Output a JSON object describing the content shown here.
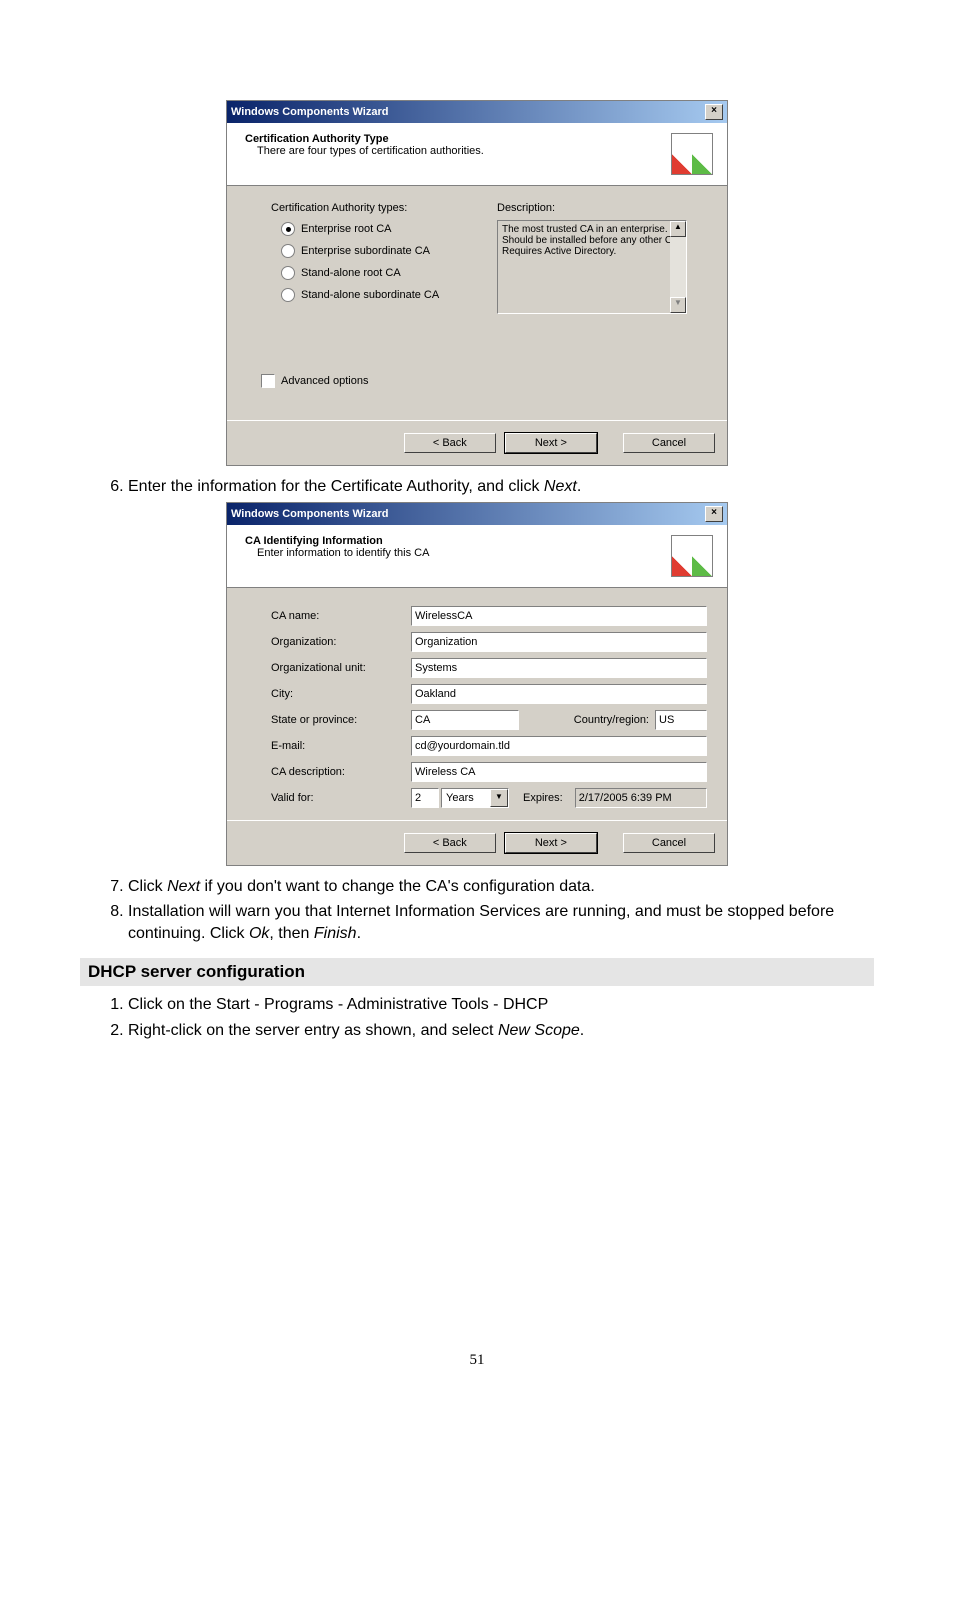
{
  "dialog1": {
    "title": "Windows Components Wizard",
    "header_title": "Certification Authority Type",
    "header_sub": "There are four types of certification authorities.",
    "types_label": "Certification Authority types:",
    "radios": [
      "Enterprise root CA",
      "Enterprise subordinate CA",
      "Stand-alone root CA",
      "Stand-alone subordinate CA"
    ],
    "desc_label": "Description:",
    "desc_text": "The most trusted CA in an enterprise. Should be installed before any other CA. Requires Active Directory.",
    "advanced": "Advanced options",
    "back": "< Back",
    "next": "Next >",
    "cancel": "Cancel"
  },
  "step6": "Enter the information for the Certificate Authority, and click ",
  "step6_em": "Next",
  "dialog2": {
    "title": "Windows Components Wizard",
    "header_title": "CA Identifying Information",
    "header_sub": "Enter information to identify this CA",
    "fields": {
      "ca_name_l": "CA name:",
      "ca_name_v": "WirelessCA",
      "org_l": "Organization:",
      "org_v": "Organization",
      "ou_l": "Organizational unit:",
      "ou_v": "Systems",
      "city_l": "City:",
      "city_v": "Oakland",
      "state_l": "State or province:",
      "state_v": "CA",
      "country_l": "Country/region:",
      "country_v": "US",
      "email_l": "E-mail:",
      "email_v": "cd@yourdomain.tld",
      "desc_l": "CA description:",
      "desc_v": "Wireless CA",
      "valid_l": "Valid for:",
      "valid_num": "2",
      "valid_unit": "Years",
      "expires_l": "Expires:",
      "expires_v": "2/17/2005 6:39 PM"
    },
    "back": "< Back",
    "next": "Next >",
    "cancel": "Cancel"
  },
  "step7_a": "Click ",
  "step7_em": "Next",
  "step7_b": " if you don't want to change the CA's configuration data.",
  "step8_a": "Installation will warn you that Internet Information Services are running, and must be stopped before continuing. Click ",
  "step8_em1": "Ok",
  "step8_b": ", then ",
  "step8_em2": "Finish",
  "section": "DHCP server configuration",
  "dhcp1": "Click on the Start - Programs - Administrative Tools - DHCP",
  "dhcp2_a": "Right-click on the server entry as shown, and select ",
  "dhcp2_em": "New Scope",
  "page_num": "51"
}
